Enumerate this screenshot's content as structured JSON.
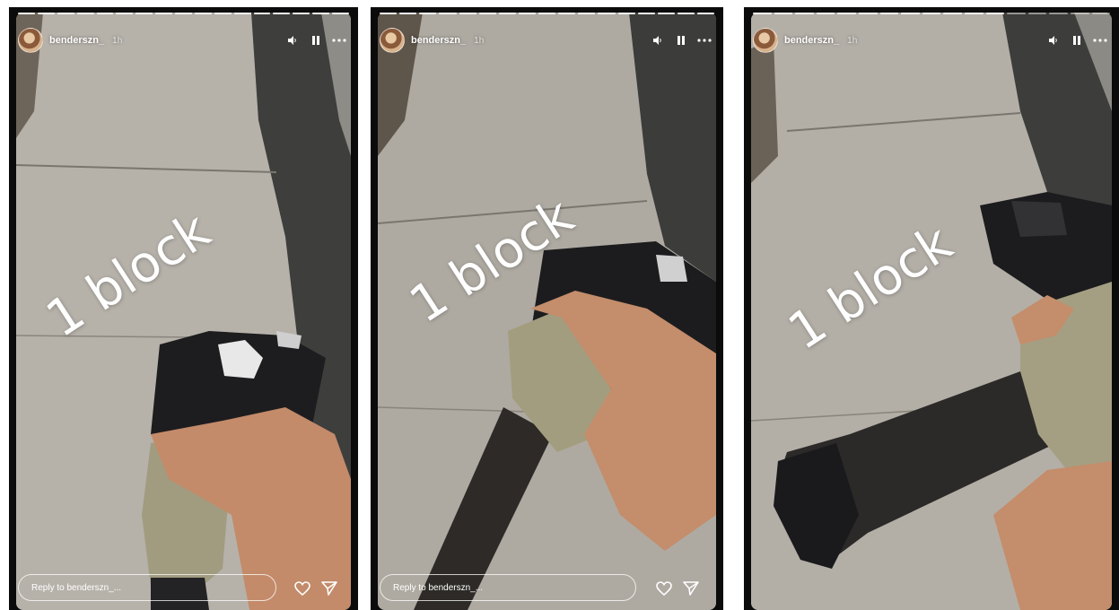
{
  "stories": [
    {
      "username": "benderszn_",
      "time": "1h",
      "overlay_text": "1 block",
      "reply_placeholder": "Reply to benderszn_...",
      "progress_segments": 17,
      "progress_filled": 17,
      "show_reply": true
    },
    {
      "username": "benderszn_",
      "time": "1h",
      "overlay_text": "1 block",
      "reply_placeholder": "Reply to benderszn_...",
      "progress_segments": 17,
      "progress_filled": 17,
      "show_reply": true
    },
    {
      "username": "benderszn_",
      "time": "1h",
      "overlay_text": "1 block",
      "reply_placeholder": "",
      "progress_segments": 17,
      "progress_filled": 12,
      "show_reply": false
    }
  ],
  "icons": {
    "volume": "volume-icon",
    "pause": "pause-icon",
    "more": "more-icon",
    "like": "heart-icon",
    "send": "send-icon"
  },
  "colors": {
    "text": "#ffffff",
    "grip": "#9a9577",
    "pavement": "#b4b0a8",
    "asphalt": "#4a4a48",
    "skin": "#c98e6c"
  }
}
